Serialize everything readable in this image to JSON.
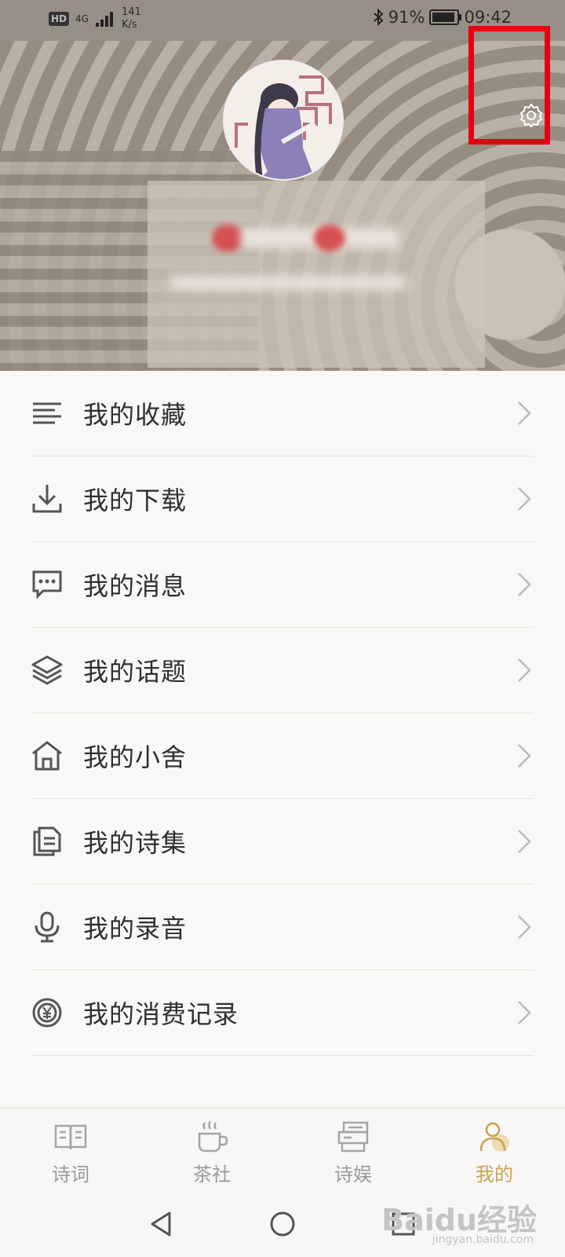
{
  "status_bar": {
    "hd": "HD",
    "network": "4G",
    "speed_value": "141",
    "speed_unit": "K/s",
    "battery": "91%",
    "battery_level": 0.91,
    "time": "09:42"
  },
  "menu": {
    "items": [
      {
        "label": "我的收藏",
        "icon": "list-icon"
      },
      {
        "label": "我的下载",
        "icon": "download-icon"
      },
      {
        "label": "我的消息",
        "icon": "message-icon"
      },
      {
        "label": "我的话题",
        "icon": "layers-icon"
      },
      {
        "label": "我的小舍",
        "icon": "home-icon"
      },
      {
        "label": "我的诗集",
        "icon": "document-icon"
      },
      {
        "label": "我的录音",
        "icon": "microphone-icon"
      },
      {
        "label": "我的消费记录",
        "icon": "yen-icon"
      }
    ]
  },
  "tabbar": {
    "tabs": [
      {
        "label": "诗词",
        "icon": "book-icon"
      },
      {
        "label": "茶社",
        "icon": "tea-cup-icon"
      },
      {
        "label": "诗娱",
        "icon": "poem-play-icon"
      },
      {
        "label": "我的",
        "icon": "person-icon",
        "active": true
      }
    ]
  },
  "colors": {
    "accent": "#c8a151",
    "highlight": "#e60012",
    "header_bg": "#a59d90"
  },
  "watermark": {
    "brand": "Baidu经验",
    "url": "jingyan.baidu.com"
  }
}
